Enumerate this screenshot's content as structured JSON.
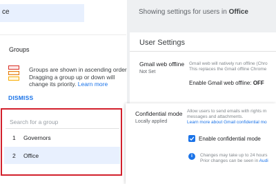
{
  "left_panel": {
    "ou_selected": "ce",
    "groups_title": "Groups",
    "groups_description": "Groups are shown in ascending order Dragging a group up or down will change its priority.",
    "learn_more": "Learn more",
    "dismiss": "DISMISS",
    "search_placeholder": "Search for a group",
    "groups": [
      {
        "number": "1",
        "name": "Governors"
      },
      {
        "number": "2",
        "name": "Office"
      }
    ]
  },
  "header": {
    "showing_prefix": "Showing settings for users in",
    "showing_org": "Office"
  },
  "user_settings": {
    "title": "User Settings",
    "gmail_offline": {
      "name": "Gmail web offline",
      "status": "Not Set",
      "desc_line1": "Gmail web will natively run offline (Chro",
      "desc_line2": "This replaces the Gmail offline Chrome",
      "value_label": "Enable Gmail web offline:",
      "value": "OFF"
    },
    "confidential": {
      "name": "Confidential mode",
      "status": "Locally applied",
      "desc_line1": "Allow users to send emails with rights m",
      "desc_line2": "messages and attachments.",
      "learn_more": "Learn more about Gmail confidential mo",
      "checkbox_label": "Enable confidential mode",
      "checkbox_checked": true,
      "note_line1": "Changes may take up to 24 hours",
      "note_line2_prefix": "Prior changes can be seen in",
      "note_line2_link": "Audi"
    }
  },
  "colors": {
    "accent": "#1a73e8",
    "highlight_border": "#d21f2b",
    "selected_row": "#e8f0fe"
  }
}
